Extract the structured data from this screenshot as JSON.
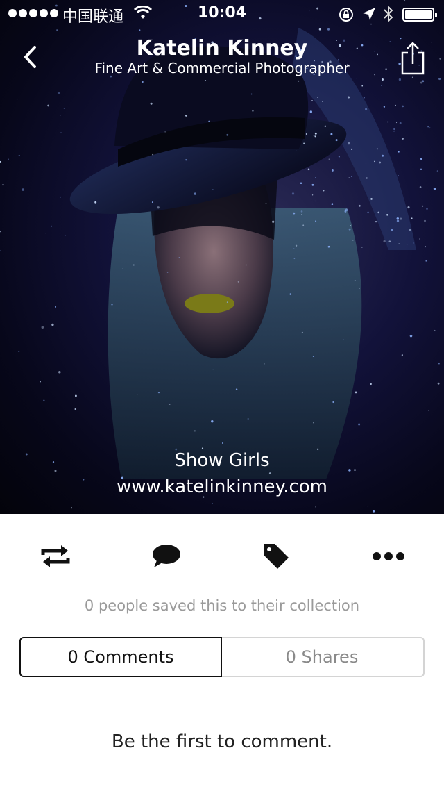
{
  "status_bar": {
    "carrier": "中国联通",
    "time": "10:04",
    "battery_level_pct": 100
  },
  "header": {
    "title": "Katelin Kinney",
    "subtitle": "Fine Art & Commercial Photographer"
  },
  "photo": {
    "caption_title": "Show Girls",
    "caption_url": "www.katelinkinney.com"
  },
  "actions": {
    "items": [
      {
        "icon": "repost-icon"
      },
      {
        "icon": "comment-icon"
      },
      {
        "icon": "tag-icon"
      },
      {
        "icon": "more-icon"
      }
    ]
  },
  "saved_text": "0 people saved this to their collection",
  "tabs": {
    "comments": "0 Comments",
    "shares": "0 Shares"
  },
  "empty_text": "Be the first to comment.",
  "colors": {
    "hero_bg": "#0a0a22",
    "text_muted": "#9a9a9a",
    "active_border": "#111111",
    "inactive_border": "#d4d4d4"
  }
}
